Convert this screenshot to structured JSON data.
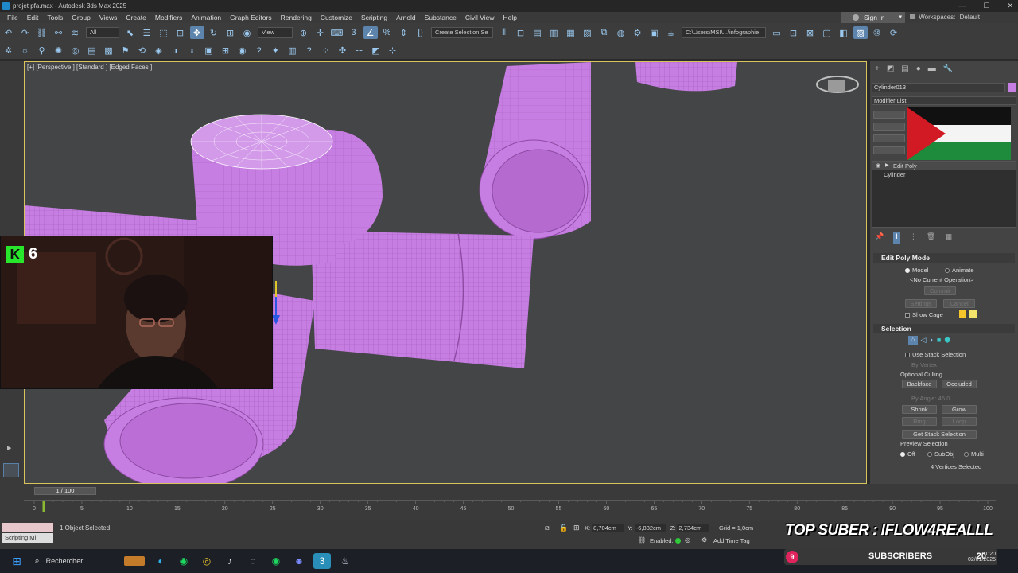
{
  "window": {
    "title": "projet pfa.max - Autodesk 3ds Max 2025"
  },
  "menu": [
    "File",
    "Edit",
    "Tools",
    "Group",
    "Views",
    "Create",
    "Modifiers",
    "Animation",
    "Graph Editors",
    "Rendering",
    "Customize",
    "Scripting",
    "Arnold",
    "Substance",
    "Civil View",
    "Help"
  ],
  "account": {
    "signin": "Sign In",
    "workspaces_label": "Workspaces:",
    "workspaces_value": "Default"
  },
  "toolbar": {
    "filter": "All",
    "refcoord": "View",
    "selection_set": "Create Selection Se",
    "path": "C:\\Users\\MSI\\...\\infographie"
  },
  "viewport": {
    "label": "[+] [Perspective ] [Standard ] [Edged Faces ]"
  },
  "webcam": {
    "badge_letter": "K",
    "viewers": "6"
  },
  "panel": {
    "object_name": "Cylinder013",
    "modifier_list": "Modifier List",
    "stack": [
      "Edit Poly",
      "Cylinder"
    ],
    "edit_poly_mode": {
      "title": "Edit Poly Mode",
      "model": "Model",
      "animate": "Animate",
      "operation": "<No Current Operation>",
      "commit": "Commit",
      "settings": "Settings",
      "cancel": "Cancel",
      "show_cage": "Show Cage",
      "cage_colors": [
        "#f7c62a",
        "#f2e36a"
      ]
    },
    "selection": {
      "title": "Selection",
      "use_stack": "Use Stack Selection",
      "by_vertex": "By Vertex",
      "optional_culling": "Optional Culling",
      "backface": "Backface",
      "occluded": "Occluded",
      "by_angle": "By Angle:",
      "angle_value": "45,0",
      "shrink": "Shrink",
      "grow": "Grow",
      "ring": "Ring",
      "loop": "Loop",
      "get_stack": "Get Stack Selection",
      "preview_selection": "Preview Selection",
      "off": "Off",
      "subobj": "SubObj",
      "multi": "Multi",
      "status": "4 Vertices Selected"
    }
  },
  "timeline": {
    "frame": "1 / 100",
    "ticks": [
      "0",
      "5",
      "10",
      "15",
      "20",
      "25",
      "30",
      "35",
      "40",
      "45",
      "50",
      "55",
      "60",
      "65",
      "70",
      "75",
      "80",
      "85",
      "90",
      "95",
      "100"
    ]
  },
  "status": {
    "script_label": "Scripting Mi",
    "selected": "1 Object Selected",
    "x_label": "X:",
    "x": "8,704cm",
    "y_label": "Y:",
    "y": "-6,832cm",
    "z_label": "Z:",
    "z": "2,734cm",
    "grid": "Grid = 1,0cm",
    "enabled": "Enabled:",
    "add_time_tag": "Add Time Tag"
  },
  "overlay": {
    "top_suber": "TOP SUBER : IFLOW4REALLL",
    "subscribers_count": "9",
    "subscribers_label": "SUBSCRIBERS",
    "subscribers_total": "20"
  },
  "taskbar": {
    "search": "Rechercher",
    "time": "01:20",
    "date": "02/01/2025"
  },
  "colors": {
    "object": "#c77ee2",
    "viewport_bg": "#444546",
    "accent": "#5d84ad"
  }
}
